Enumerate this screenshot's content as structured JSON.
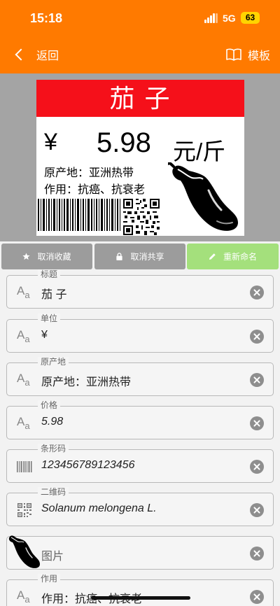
{
  "status_bar": {
    "time": "15:18",
    "network": "5G",
    "battery": "63"
  },
  "nav": {
    "back_label": "返回",
    "template_label": "模板",
    "template_icon": "book-icon"
  },
  "label": {
    "title": "茄 子",
    "currency": "¥",
    "price": "5.98",
    "unit": "元/斤",
    "origin": "原产地：亚洲热带",
    "use": "作用：抗癌、抗衰老",
    "colors": {
      "title_bg": "#f5101a",
      "title_text": "#ffffff"
    }
  },
  "actions": [
    {
      "label": "取消收藏",
      "icon": "star-icon"
    },
    {
      "label": "取消共享",
      "icon": "lock-icon"
    },
    {
      "label": "重新命名",
      "icon": "pencil-icon"
    }
  ],
  "fields": [
    {
      "legend": "标题",
      "value": "茄 子",
      "icon": "text-icon"
    },
    {
      "legend": "单位",
      "value": "¥",
      "icon": "text-icon"
    },
    {
      "legend": "原产地",
      "value": "原产地：亚洲热带",
      "icon": "text-icon"
    },
    {
      "legend": "价格",
      "value": "5.98",
      "icon": "text-icon"
    },
    {
      "legend": "条形码",
      "value": "123456789123456",
      "icon": "barcode-icon"
    },
    {
      "legend": "二维码",
      "value": "Solanum melongena L.",
      "icon": "qrcode-icon"
    },
    {
      "legend": "",
      "value": "图片",
      "icon": "eggplant-image"
    },
    {
      "legend": "作用",
      "value": "作用：抗癌、抗衰老",
      "icon": "text-icon"
    }
  ],
  "colors": {
    "header": "#ff7a00",
    "preview_bg": "#a4a4a4",
    "button_gray": "#9c9c9c",
    "button_green": "#a4e07c"
  }
}
